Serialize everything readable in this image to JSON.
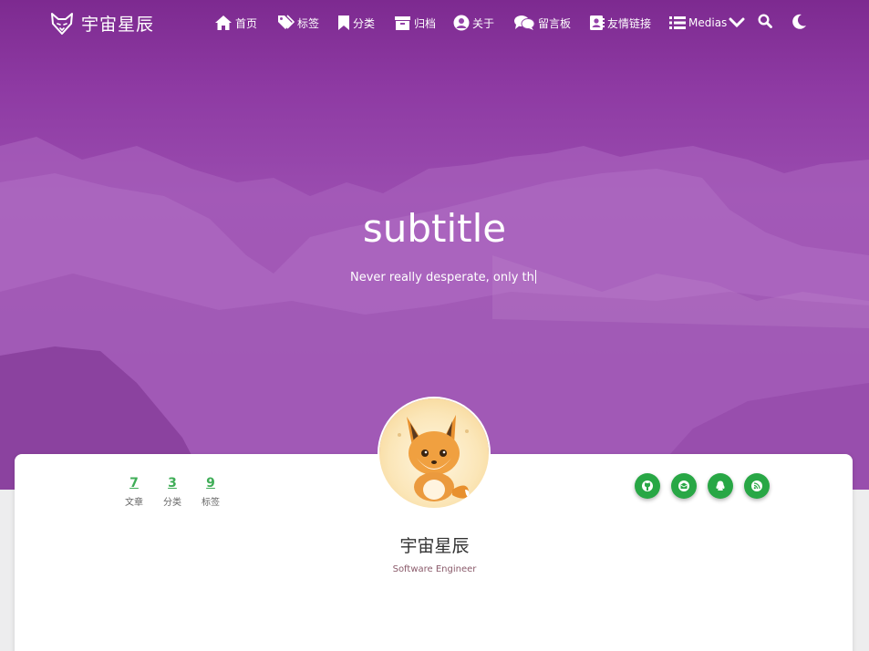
{
  "brand": {
    "name": "宇宙星辰",
    "icon": "fox-logo-icon"
  },
  "nav": {
    "items": [
      {
        "label": "首页",
        "icon": "home-icon"
      },
      {
        "label": "标签",
        "icon": "tags-icon"
      },
      {
        "label": "分类",
        "icon": "bookmark-icon"
      },
      {
        "label": "归档",
        "icon": "archive-icon"
      },
      {
        "label": "关于",
        "icon": "user-circle-icon"
      },
      {
        "label": "留言板",
        "icon": "comments-icon"
      },
      {
        "label": "友情链接",
        "icon": "address-card-icon"
      },
      {
        "label": "Medias",
        "icon": "list-icon"
      }
    ],
    "search_icon": "search-icon",
    "theme_icon": "moon-icon"
  },
  "hero": {
    "title": "subtitle",
    "subtitle": "Never really desperate, only th"
  },
  "profile": {
    "name": "宇宙星辰",
    "role": "Software Engineer",
    "stats": [
      {
        "count": "7",
        "label": "文章"
      },
      {
        "count": "3",
        "label": "分类"
      },
      {
        "count": "9",
        "label": "标签"
      }
    ],
    "social": [
      "github-icon",
      "email-icon",
      "qq-icon",
      "rss-icon"
    ]
  },
  "colors": {
    "hero": "#9443a9",
    "accent": "#3fad57",
    "social": "#28a745"
  }
}
